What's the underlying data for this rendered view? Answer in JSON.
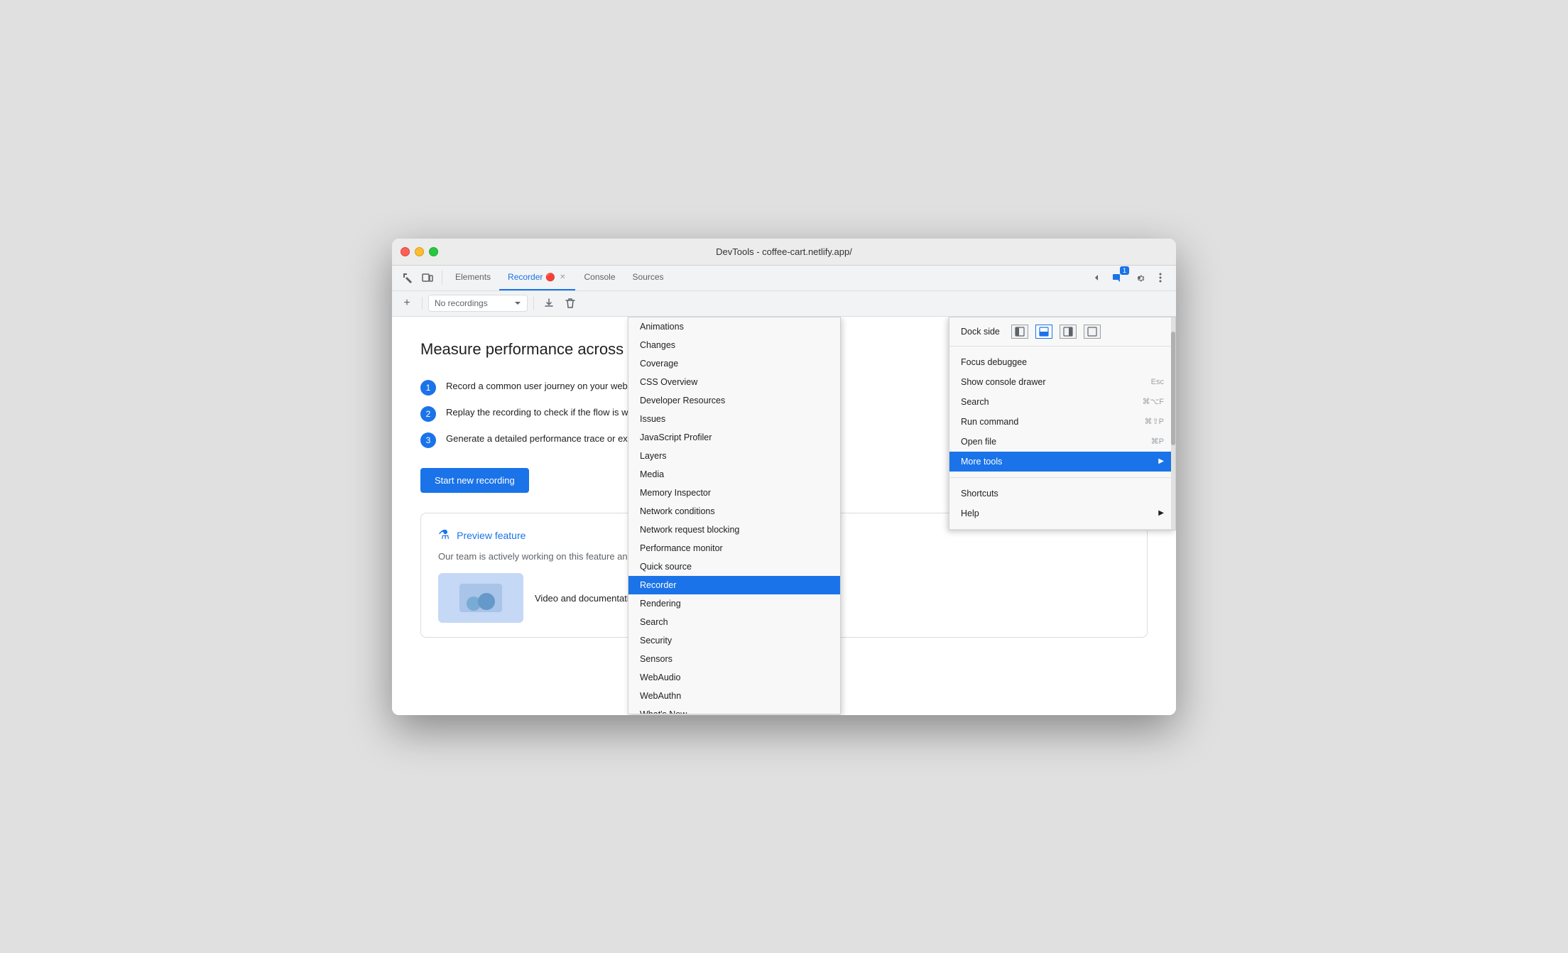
{
  "window": {
    "title": "DevTools - coffee-cart.netlify.app/"
  },
  "tabs": [
    {
      "id": "elements",
      "label": "Elements",
      "active": false
    },
    {
      "id": "recorder",
      "label": "Recorder",
      "active": true,
      "closable": true
    },
    {
      "id": "console",
      "label": "Console",
      "active": false
    },
    {
      "id": "sources",
      "label": "Sources",
      "active": false
    }
  ],
  "toolbar": {
    "recordings_label": "No recordings"
  },
  "main": {
    "heading": "Measure performance across an entire user",
    "steps": [
      {
        "num": "1",
        "text": "Record a common user journey on your website or a"
      },
      {
        "num": "2",
        "text": "Replay the recording to check if the flow is working"
      },
      {
        "num": "3",
        "text": "Generate a detailed performance trace or export a P"
      }
    ],
    "start_button": "Start new recording",
    "preview": {
      "title": "Preview feature",
      "text": "Our team is actively working on this feature and we are lo",
      "video_label": "Video and documentation"
    }
  },
  "more_tools_menu": {
    "items": [
      {
        "id": "animations",
        "label": "Animations"
      },
      {
        "id": "changes",
        "label": "Changes"
      },
      {
        "id": "coverage",
        "label": "Coverage"
      },
      {
        "id": "css-overview",
        "label": "CSS Overview"
      },
      {
        "id": "developer-resources",
        "label": "Developer Resources"
      },
      {
        "id": "issues",
        "label": "Issues"
      },
      {
        "id": "javascript-profiler",
        "label": "JavaScript Profiler"
      },
      {
        "id": "layers",
        "label": "Layers"
      },
      {
        "id": "media",
        "label": "Media"
      },
      {
        "id": "memory-inspector",
        "label": "Memory Inspector"
      },
      {
        "id": "network-conditions",
        "label": "Network conditions"
      },
      {
        "id": "network-request-blocking",
        "label": "Network request blocking"
      },
      {
        "id": "performance-monitor",
        "label": "Performance monitor"
      },
      {
        "id": "quick-source",
        "label": "Quick source"
      },
      {
        "id": "recorder",
        "label": "Recorder",
        "active": true
      },
      {
        "id": "rendering",
        "label": "Rendering"
      },
      {
        "id": "search",
        "label": "Search"
      },
      {
        "id": "security",
        "label": "Security"
      },
      {
        "id": "sensors",
        "label": "Sensors"
      },
      {
        "id": "webaudio",
        "label": "WebAudio"
      },
      {
        "id": "webauthn",
        "label": "WebAuthn"
      },
      {
        "id": "whats-new",
        "label": "What's New"
      }
    ]
  },
  "main_menu": {
    "dock_side_label": "Dock side",
    "sections": [
      {
        "items": [
          {
            "id": "focus-debuggee",
            "label": "Focus debuggee",
            "shortcut": ""
          },
          {
            "id": "show-console-drawer",
            "label": "Show console drawer",
            "shortcut": "Esc"
          },
          {
            "id": "search",
            "label": "Search",
            "shortcut": "⌘⌥F"
          },
          {
            "id": "run-command",
            "label": "Run command",
            "shortcut": "⌘⇧P"
          },
          {
            "id": "open-file",
            "label": "Open file",
            "shortcut": "⌘P"
          },
          {
            "id": "more-tools",
            "label": "More tools",
            "active": true,
            "has_arrow": true
          }
        ]
      },
      {
        "items": [
          {
            "id": "shortcuts",
            "label": "Shortcuts",
            "shortcut": ""
          },
          {
            "id": "help",
            "label": "Help",
            "has_arrow": true
          }
        ]
      }
    ],
    "notification_count": "1"
  }
}
